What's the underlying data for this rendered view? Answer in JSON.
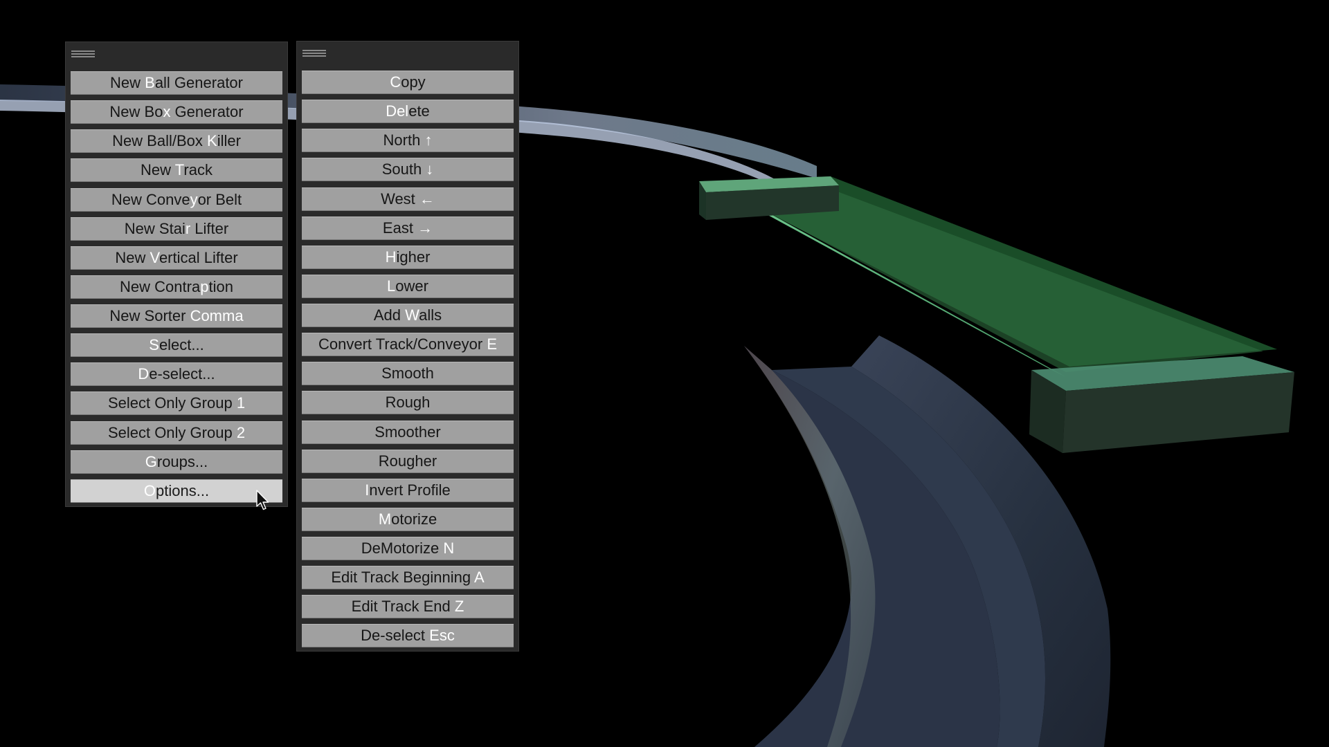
{
  "menu_left": {
    "items": [
      {
        "pre": "New ",
        "key": "B",
        "post": "all Generator"
      },
      {
        "pre": "New Bo",
        "key": "x",
        "post": " Generator"
      },
      {
        "pre": "New Ball/Box ",
        "key": "K",
        "post": "iller"
      },
      {
        "pre": "New ",
        "key": "T",
        "post": "rack"
      },
      {
        "pre": "New Conve",
        "key": "y",
        "post": "or Belt"
      },
      {
        "pre": "New Stai",
        "key": "r",
        "post": " Lifter"
      },
      {
        "pre": "New ",
        "key": "V",
        "post": "ertical Lifter"
      },
      {
        "pre": "New Contra",
        "key": "p",
        "post": "tion"
      },
      {
        "pre": "New Sorter ",
        "key": "Comma",
        "post": ""
      },
      {
        "pre": "",
        "key": "S",
        "post": "elect..."
      },
      {
        "pre": "",
        "key": "D",
        "post": "e-select..."
      },
      {
        "pre": "Select Only Group ",
        "key": "1",
        "post": ""
      },
      {
        "pre": "Select Only Group ",
        "key": "2",
        "post": ""
      },
      {
        "pre": "",
        "key": "G",
        "post": "roups..."
      },
      {
        "pre": "",
        "key": "O",
        "post": "ptions..."
      }
    ]
  },
  "menu_right": {
    "items": [
      {
        "pre": "",
        "key": "C",
        "post": "opy"
      },
      {
        "pre": "",
        "key": "Del",
        "post": "ete"
      },
      {
        "pre": "North ",
        "key": "↑",
        "post": ""
      },
      {
        "pre": "South ",
        "key": "↓",
        "post": ""
      },
      {
        "pre": "West ",
        "key": "←",
        "post": ""
      },
      {
        "pre": "East ",
        "key": "→",
        "post": ""
      },
      {
        "pre": "",
        "key": "H",
        "post": "igher"
      },
      {
        "pre": "",
        "key": "L",
        "post": "ower"
      },
      {
        "pre": "Add ",
        "key": "W",
        "post": "alls"
      },
      {
        "pre": "Convert Track/Conveyor ",
        "key": "E",
        "post": ""
      },
      {
        "pre": "Smooth",
        "key": "",
        "post": ""
      },
      {
        "pre": "Rough",
        "key": "",
        "post": ""
      },
      {
        "pre": "Smoother",
        "key": "",
        "post": ""
      },
      {
        "pre": "Rougher",
        "key": "",
        "post": ""
      },
      {
        "pre": "",
        "key": "I",
        "post": "nvert Profile"
      },
      {
        "pre": "",
        "key": "M",
        "post": "otorize"
      },
      {
        "pre": "DeMotorize ",
        "key": "N",
        "post": ""
      },
      {
        "pre": "Edit Track Beginning ",
        "key": "A",
        "post": ""
      },
      {
        "pre": "Edit Track End ",
        "key": "Z",
        "post": ""
      },
      {
        "pre": "De-select ",
        "key": "Esc",
        "post": ""
      }
    ]
  },
  "hovered_item": "Options...",
  "colors": {
    "background": "#000000",
    "panel": "#2a2a2a",
    "button": "#a0a0a0",
    "button_hover": "#d2d2d2",
    "button_text": "#161616",
    "hotkey_text": "#ffffff",
    "track_green": "#3f8c52",
    "track_blue": "#9fb4d6",
    "ramp_slate": "#2a3345"
  }
}
